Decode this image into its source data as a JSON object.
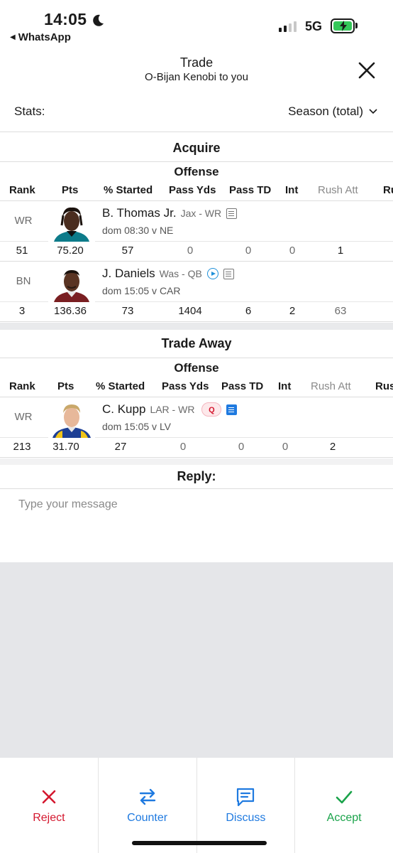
{
  "status_bar": {
    "time": "14:05",
    "back_app": "WhatsApp",
    "network": "5G"
  },
  "header": {
    "title": "Trade",
    "subtitle": "O-Bijan Kenobi to you"
  },
  "stats": {
    "label": "Stats:",
    "selected": "Season (total)"
  },
  "columns": [
    "Rank",
    "Pts",
    "% Started",
    "Pass Yds",
    "Pass TD",
    "Int",
    "Rush Att",
    "Ru"
  ],
  "columns_away": [
    "Rank",
    "Pts",
    "% Started",
    "Pass Yds",
    "Pass TD",
    "Int",
    "Rush Att",
    "Rus"
  ],
  "acquire": {
    "title": "Acquire",
    "group": "Offense",
    "players": [
      {
        "pos": "WR",
        "name": "B. Thomas Jr.",
        "team": "Jax - WR",
        "game": "dom 08:30 v NE",
        "stats": [
          "51",
          "75.20",
          "57",
          "0",
          "0",
          "0",
          "1",
          ""
        ]
      },
      {
        "pos": "BN",
        "name": "J. Daniels",
        "team": "Was - QB",
        "game": "dom 15:05 v CAR",
        "stats": [
          "3",
          "136.36",
          "73",
          "1404",
          "6",
          "2",
          "63",
          ""
        ]
      }
    ]
  },
  "trade_away": {
    "title": "Trade Away",
    "group": "Offense",
    "players": [
      {
        "pos": "WR",
        "name": "C. Kupp",
        "team": "LAR - WR",
        "badge": "Q",
        "game": "dom 15:05 v LV",
        "stats": [
          "213",
          "31.70",
          "27",
          "0",
          "0",
          "0",
          "2",
          ""
        ]
      }
    ]
  },
  "reply": {
    "label": "Reply:",
    "placeholder": "Type your message"
  },
  "actions": {
    "reject": "Reject",
    "counter": "Counter",
    "discuss": "Discuss",
    "accept": "Accept"
  },
  "colors": {
    "reject": "#d4182f",
    "counter": "#1f7ae0",
    "discuss": "#1f7ae0",
    "accept": "#1aa34a",
    "battery": "#34c759"
  }
}
